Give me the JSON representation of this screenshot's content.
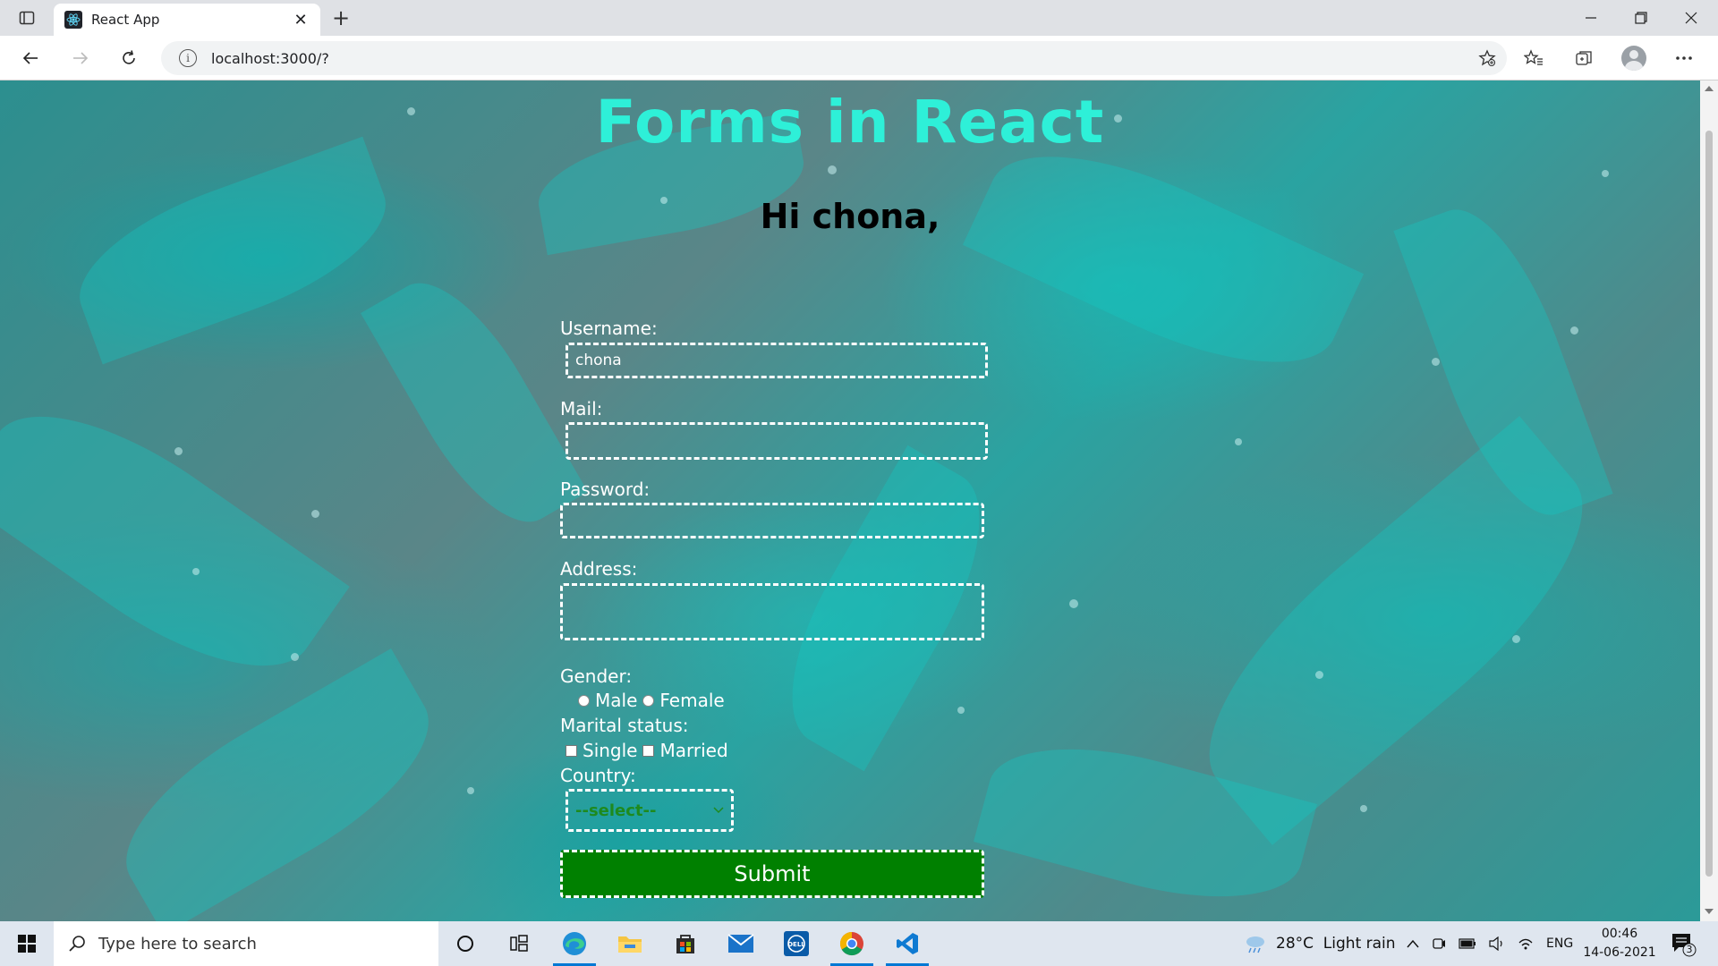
{
  "browser": {
    "tab_title": "React App",
    "url": "localhost:3000/?",
    "window_controls": [
      "minimize",
      "restore",
      "close"
    ]
  },
  "page": {
    "title": "Forms in React",
    "greeting": "Hi chona,",
    "form": {
      "username_label": "Username:",
      "username_value": "chona",
      "mail_label": "Mail:",
      "mail_value": "",
      "password_label": "Password:",
      "password_value": "",
      "address_label": "Address:",
      "address_value": "",
      "gender_label": "Gender:",
      "gender_options": [
        "Male",
        "Female"
      ],
      "marital_label": "Marital status:",
      "marital_options": [
        "Single",
        "Married"
      ],
      "country_label": "Country:",
      "country_selected": "--select--",
      "submit_label": "Submit"
    },
    "colors": {
      "title": "#2ef0d8",
      "submit_bg": "#008000",
      "select_text": "#1e8a1e"
    }
  },
  "taskbar": {
    "search_placeholder": "Type here to search",
    "weather": "28°C  Light rain",
    "language": "ENG",
    "time": "00:46",
    "date": "14-06-2021",
    "notification_count": "3",
    "pinned_apps": [
      "cortana-icon",
      "task-view-icon",
      "edge-icon",
      "file-explorer-icon",
      "store-icon",
      "mail-icon",
      "dell-icon",
      "chrome-icon",
      "vscode-icon"
    ]
  }
}
